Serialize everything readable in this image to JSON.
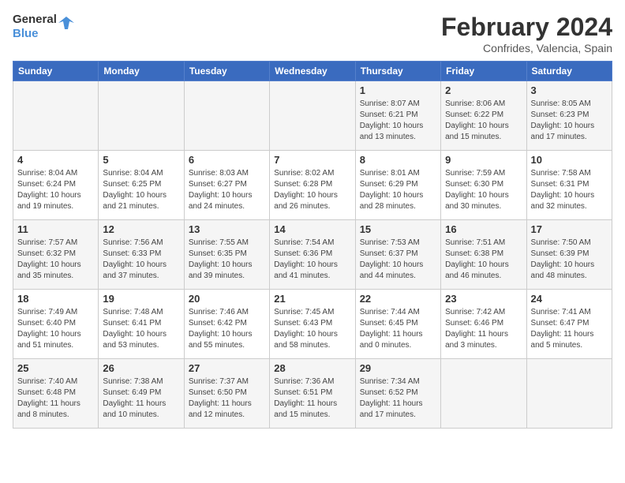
{
  "header": {
    "logo_line1": "General",
    "logo_line2": "Blue",
    "month_title": "February 2024",
    "location": "Confrides, Valencia, Spain"
  },
  "weekdays": [
    "Sunday",
    "Monday",
    "Tuesday",
    "Wednesday",
    "Thursday",
    "Friday",
    "Saturday"
  ],
  "weeks": [
    [
      {
        "num": "",
        "info": ""
      },
      {
        "num": "",
        "info": ""
      },
      {
        "num": "",
        "info": ""
      },
      {
        "num": "",
        "info": ""
      },
      {
        "num": "1",
        "info": "Sunrise: 8:07 AM\nSunset: 6:21 PM\nDaylight: 10 hours\nand 13 minutes."
      },
      {
        "num": "2",
        "info": "Sunrise: 8:06 AM\nSunset: 6:22 PM\nDaylight: 10 hours\nand 15 minutes."
      },
      {
        "num": "3",
        "info": "Sunrise: 8:05 AM\nSunset: 6:23 PM\nDaylight: 10 hours\nand 17 minutes."
      }
    ],
    [
      {
        "num": "4",
        "info": "Sunrise: 8:04 AM\nSunset: 6:24 PM\nDaylight: 10 hours\nand 19 minutes."
      },
      {
        "num": "5",
        "info": "Sunrise: 8:04 AM\nSunset: 6:25 PM\nDaylight: 10 hours\nand 21 minutes."
      },
      {
        "num": "6",
        "info": "Sunrise: 8:03 AM\nSunset: 6:27 PM\nDaylight: 10 hours\nand 24 minutes."
      },
      {
        "num": "7",
        "info": "Sunrise: 8:02 AM\nSunset: 6:28 PM\nDaylight: 10 hours\nand 26 minutes."
      },
      {
        "num": "8",
        "info": "Sunrise: 8:01 AM\nSunset: 6:29 PM\nDaylight: 10 hours\nand 28 minutes."
      },
      {
        "num": "9",
        "info": "Sunrise: 7:59 AM\nSunset: 6:30 PM\nDaylight: 10 hours\nand 30 minutes."
      },
      {
        "num": "10",
        "info": "Sunrise: 7:58 AM\nSunset: 6:31 PM\nDaylight: 10 hours\nand 32 minutes."
      }
    ],
    [
      {
        "num": "11",
        "info": "Sunrise: 7:57 AM\nSunset: 6:32 PM\nDaylight: 10 hours\nand 35 minutes."
      },
      {
        "num": "12",
        "info": "Sunrise: 7:56 AM\nSunset: 6:33 PM\nDaylight: 10 hours\nand 37 minutes."
      },
      {
        "num": "13",
        "info": "Sunrise: 7:55 AM\nSunset: 6:35 PM\nDaylight: 10 hours\nand 39 minutes."
      },
      {
        "num": "14",
        "info": "Sunrise: 7:54 AM\nSunset: 6:36 PM\nDaylight: 10 hours\nand 41 minutes."
      },
      {
        "num": "15",
        "info": "Sunrise: 7:53 AM\nSunset: 6:37 PM\nDaylight: 10 hours\nand 44 minutes."
      },
      {
        "num": "16",
        "info": "Sunrise: 7:51 AM\nSunset: 6:38 PM\nDaylight: 10 hours\nand 46 minutes."
      },
      {
        "num": "17",
        "info": "Sunrise: 7:50 AM\nSunset: 6:39 PM\nDaylight: 10 hours\nand 48 minutes."
      }
    ],
    [
      {
        "num": "18",
        "info": "Sunrise: 7:49 AM\nSunset: 6:40 PM\nDaylight: 10 hours\nand 51 minutes."
      },
      {
        "num": "19",
        "info": "Sunrise: 7:48 AM\nSunset: 6:41 PM\nDaylight: 10 hours\nand 53 minutes."
      },
      {
        "num": "20",
        "info": "Sunrise: 7:46 AM\nSunset: 6:42 PM\nDaylight: 10 hours\nand 55 minutes."
      },
      {
        "num": "21",
        "info": "Sunrise: 7:45 AM\nSunset: 6:43 PM\nDaylight: 10 hours\nand 58 minutes."
      },
      {
        "num": "22",
        "info": "Sunrise: 7:44 AM\nSunset: 6:45 PM\nDaylight: 11 hours\nand 0 minutes."
      },
      {
        "num": "23",
        "info": "Sunrise: 7:42 AM\nSunset: 6:46 PM\nDaylight: 11 hours\nand 3 minutes."
      },
      {
        "num": "24",
        "info": "Sunrise: 7:41 AM\nSunset: 6:47 PM\nDaylight: 11 hours\nand 5 minutes."
      }
    ],
    [
      {
        "num": "25",
        "info": "Sunrise: 7:40 AM\nSunset: 6:48 PM\nDaylight: 11 hours\nand 8 minutes."
      },
      {
        "num": "26",
        "info": "Sunrise: 7:38 AM\nSunset: 6:49 PM\nDaylight: 11 hours\nand 10 minutes."
      },
      {
        "num": "27",
        "info": "Sunrise: 7:37 AM\nSunset: 6:50 PM\nDaylight: 11 hours\nand 12 minutes."
      },
      {
        "num": "28",
        "info": "Sunrise: 7:36 AM\nSunset: 6:51 PM\nDaylight: 11 hours\nand 15 minutes."
      },
      {
        "num": "29",
        "info": "Sunrise: 7:34 AM\nSunset: 6:52 PM\nDaylight: 11 hours\nand 17 minutes."
      },
      {
        "num": "",
        "info": ""
      },
      {
        "num": "",
        "info": ""
      }
    ]
  ]
}
